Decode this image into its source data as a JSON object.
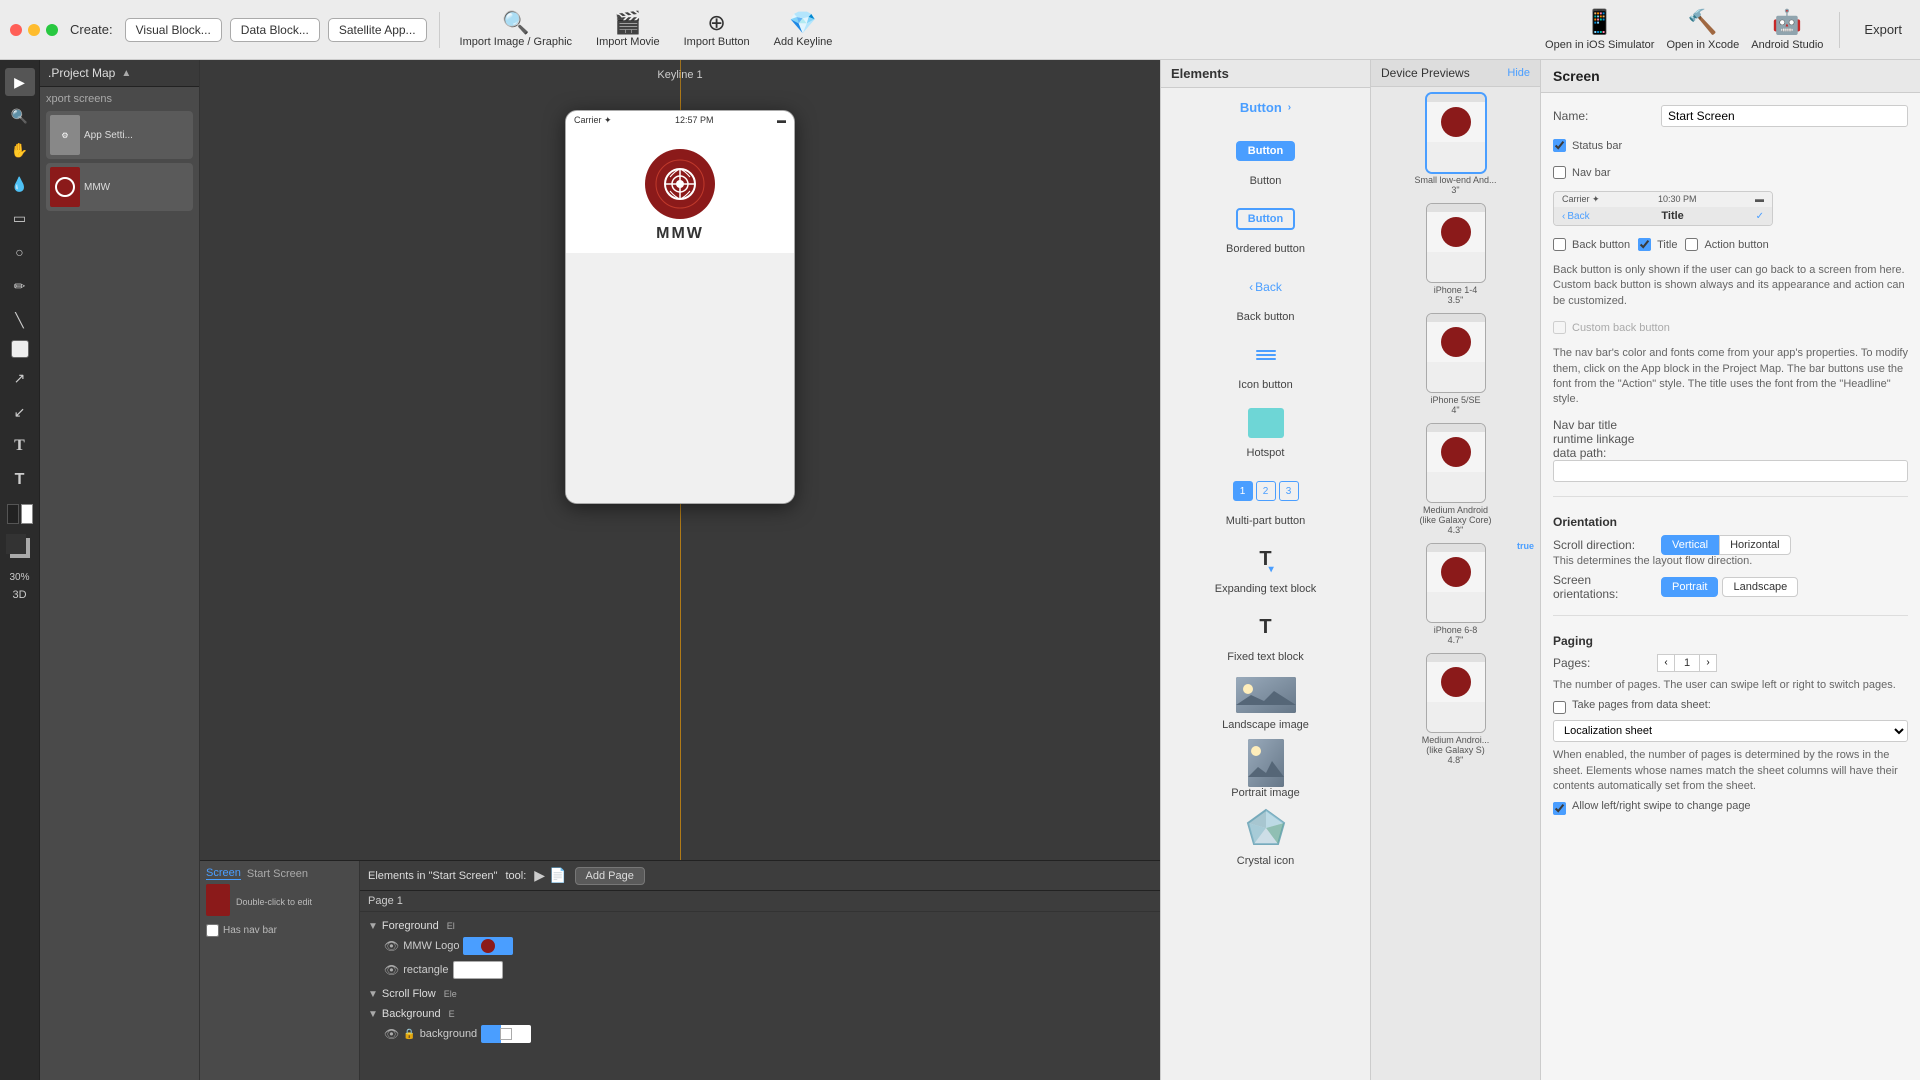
{
  "toolbar": {
    "create_label": "Create:",
    "buttons": [
      "Visual Block...",
      "Data Block...",
      "Satellite App..."
    ],
    "actions": [
      {
        "label": "Import Image / Graphic",
        "icon": "🖼"
      },
      {
        "label": "Import Movie",
        "icon": "🎬"
      },
      {
        "label": "Import Button",
        "icon": "🔘"
      },
      {
        "label": "Add Keyline",
        "icon": "💎"
      }
    ],
    "right_actions": [
      {
        "label": "Open in iOS Simulator",
        "icon": "📱"
      },
      {
        "label": "Open in Xcode",
        "icon": "🔨"
      },
      {
        "label": "Android Studio",
        "icon": "🤖"
      }
    ],
    "export_label": "Export"
  },
  "project_map": {
    "title": ".Project Map",
    "screens_label": "xport screens",
    "screen_items": [
      {
        "label": "App Setti...",
        "thumb": "gear"
      },
      {
        "label": "MMW",
        "thumb": "logo"
      }
    ]
  },
  "canvas": {
    "keyline_label": "Keyline 1",
    "phone": {
      "carrier": "Carrier ✦",
      "time": "12:57 PM",
      "brand": "MMW"
    }
  },
  "tools": [
    "cursor",
    "magnify",
    "hand",
    "droplet",
    "rect",
    "ellipse",
    "pencil",
    "line",
    "square",
    "cursor2",
    "cursor3",
    "text1",
    "text2",
    "color"
  ],
  "elements": {
    "header": "Elements",
    "group_header": "Button",
    "items": [
      {
        "label": "Button",
        "type": "button-filled"
      },
      {
        "label": "Bordered button",
        "type": "button-bordered"
      },
      {
        "label": "Back button",
        "type": "back-button"
      },
      {
        "label": "Icon button",
        "type": "icon-button"
      },
      {
        "label": "Hotspot",
        "type": "hotspot"
      },
      {
        "label": "Multi-part button",
        "type": "multi-button"
      },
      {
        "label": "Expanding text block",
        "type": "expanding-text"
      },
      {
        "label": "Fixed text block",
        "type": "fixed-text"
      },
      {
        "label": "Landscape image",
        "type": "landscape-image"
      },
      {
        "label": "Portrait image",
        "type": "portrait-image"
      },
      {
        "label": "Crystal icon",
        "type": "crystal"
      }
    ]
  },
  "device_previews": {
    "header": "Device Previews",
    "hide_label": "Hide",
    "devices": [
      {
        "label": "Small low-end And...\n3\"",
        "active": true
      },
      {
        "label": "iPhone 1-4\n3.5\"",
        "active": false
      },
      {
        "label": "iPhone 5/SE\n4\"",
        "active": false
      },
      {
        "label": "Medium Android\n(like Galaxy Core)\n4.3\"",
        "active": false
      },
      {
        "label": "iPhone 6-8\n4.7\"",
        "active": false,
        "base_format": true
      },
      {
        "label": "Medium Androi...\n(like Galaxy S)\n4.8\"",
        "active": false
      }
    ]
  },
  "right_panel": {
    "header": "Screen",
    "name_label": "Name:",
    "name_value": "Start Screen",
    "status_bar_label": "Status bar",
    "nav_bar_label": "Nav bar",
    "nav_preview": {
      "time": "10:30 PM",
      "back_label": "Back",
      "title_label": "Title"
    },
    "nav_options": {
      "back_button_label": "Back button",
      "title_label": "Title",
      "action_button_label": "Action button"
    },
    "back_button_desc": "Back button is only shown if the user can go back to a screen from here. Custom back button is shown always and its appearance and action can be customized.",
    "custom_back_button_label": "Custom back button",
    "nav_color_desc": "The nav bar's color and fonts come from your app's properties. To modify them, click on the App block in the Project Map. The bar buttons use the font from the \"Action\" style. The title uses the font from the \"Headline\" style.",
    "linkage_label": "Nav bar title runtime linkage data path:",
    "linkage_value": "",
    "orientation_label": "Orientation",
    "scroll_direction_label": "Scroll direction:",
    "scroll_vertical": "Vertical",
    "scroll_horizontal": "Horizontal",
    "scroll_desc": "This determines the layout flow direction.",
    "screen_orientations_label": "Screen orientations:",
    "portrait_label": "Portrait",
    "landscape_label": "Landscape",
    "paging_label": "Paging",
    "pages_label": "Pages:",
    "pages_value": "1",
    "pages_desc": "The number of pages. The user can swipe left or right to switch pages.",
    "take_pages_label": "Take pages from data sheet:",
    "localization_label": "Localization sheet",
    "take_pages_desc": "When enabled, the number of pages is determined by the rows in the sheet. Elements whose names match the sheet columns will have their contents automatically set from the sheet.",
    "allow_swipe_label": "Allow left/right swipe to change page"
  },
  "bottom": {
    "screen_tab": "Screen",
    "screen_name": "Start Screen",
    "double_click": "Double-click\nto edit",
    "has_nav_bar": "Has nav bar",
    "elements_label": "Elements in \"Start Screen\"",
    "tool_label": "tool:",
    "add_page": "Add Page",
    "page_label": "Page 1",
    "foreground_label": "Foreground",
    "foreground_badge": "El",
    "scroll_flow_label": "Scroll Flow",
    "scroll_flow_badge": "Ele",
    "background_label": "Background",
    "background_badge": "E",
    "layers": [
      {
        "name": "MMW Logo",
        "type": "logo"
      },
      {
        "name": "rectangle",
        "type": "rect"
      }
    ],
    "bg_layers": [
      {
        "name": "background",
        "type": "bg"
      }
    ]
  }
}
